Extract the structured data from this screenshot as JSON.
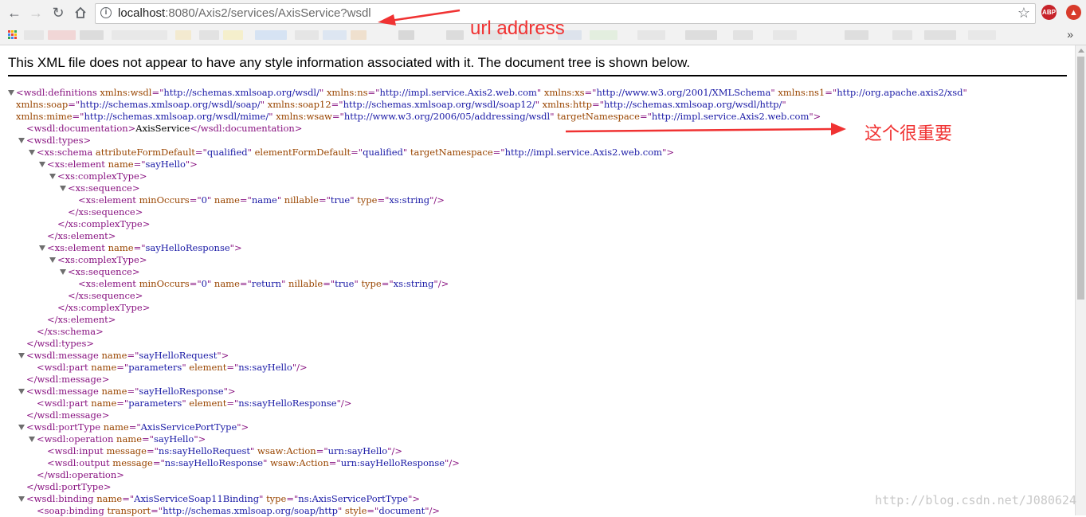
{
  "browser": {
    "url_host": "localhost",
    "url_rest": ":8080/Axis2/services/AxisService?wsdl",
    "extensions": [
      {
        "label": "ABP",
        "color": "#c7232a"
      },
      {
        "label": "",
        "color": "#d83b2b"
      }
    ]
  },
  "annotations": {
    "url_label": "url address",
    "namespace_label": "这个很重要",
    "color": "#f03232"
  },
  "page": {
    "notice": "This XML file does not appear to have any style information associated with it. The document tree is shown below."
  },
  "xml_lines": [
    {
      "indent": 0,
      "toggle": true,
      "parts": [
        [
          "t",
          "<wsdl:definitions"
        ],
        [
          "s",
          " "
        ],
        [
          "a",
          "xmlns:wsdl"
        ],
        [
          "t",
          "=\""
        ],
        [
          "v",
          "http://schemas.xmlsoap.org/wsdl/"
        ],
        [
          "t",
          "\""
        ],
        [
          "s",
          " "
        ],
        [
          "a",
          "xmlns:ns"
        ],
        [
          "t",
          "=\""
        ],
        [
          "v",
          "http://impl.service.Axis2.web.com"
        ],
        [
          "t",
          "\""
        ],
        [
          "s",
          " "
        ],
        [
          "a",
          "xmlns:xs"
        ],
        [
          "t",
          "=\""
        ],
        [
          "v",
          "http://www.w3.org/2001/XMLSchema"
        ],
        [
          "t",
          "\""
        ],
        [
          "s",
          " "
        ],
        [
          "a",
          "xmlns:ns1"
        ],
        [
          "t",
          "=\""
        ],
        [
          "v",
          "http://org.apache.axis2/xsd"
        ],
        [
          "t",
          "\""
        ]
      ]
    },
    {
      "indent": 0,
      "wrap": true,
      "parts": [
        [
          "a",
          "xmlns:soap"
        ],
        [
          "t",
          "=\""
        ],
        [
          "v",
          "http://schemas.xmlsoap.org/wsdl/soap/"
        ],
        [
          "t",
          "\""
        ],
        [
          "s",
          " "
        ],
        [
          "a",
          "xmlns:soap12"
        ],
        [
          "t",
          "=\""
        ],
        [
          "v",
          "http://schemas.xmlsoap.org/wsdl/soap12/"
        ],
        [
          "t",
          "\""
        ],
        [
          "s",
          " "
        ],
        [
          "a",
          "xmlns:http"
        ],
        [
          "t",
          "=\""
        ],
        [
          "v",
          "http://schemas.xmlsoap.org/wsdl/http/"
        ],
        [
          "t",
          "\""
        ]
      ]
    },
    {
      "indent": 0,
      "wrap": true,
      "parts": [
        [
          "a",
          "xmlns:mime"
        ],
        [
          "t",
          "=\""
        ],
        [
          "v",
          "http://schemas.xmlsoap.org/wsdl/mime/"
        ],
        [
          "t",
          "\""
        ],
        [
          "s",
          " "
        ],
        [
          "a",
          "xmlns:wsaw"
        ],
        [
          "t",
          "=\""
        ],
        [
          "v",
          "http://www.w3.org/2006/05/addressing/wsdl"
        ],
        [
          "t",
          "\""
        ],
        [
          "s",
          " "
        ],
        [
          "a",
          "targetNamespace"
        ],
        [
          "t",
          "=\""
        ],
        [
          "v",
          "http://impl.service.Axis2.web.com"
        ],
        [
          "t",
          "\">"
        ]
      ]
    },
    {
      "indent": 1,
      "parts": [
        [
          "t",
          "<wsdl:documentation>"
        ],
        [
          "x",
          "AxisService"
        ],
        [
          "t",
          "</wsdl:documentation>"
        ]
      ]
    },
    {
      "indent": 1,
      "toggle": true,
      "parts": [
        [
          "t",
          "<wsdl:types>"
        ]
      ]
    },
    {
      "indent": 2,
      "toggle": true,
      "parts": [
        [
          "t",
          "<xs:schema"
        ],
        [
          "s",
          " "
        ],
        [
          "a",
          "attributeFormDefault"
        ],
        [
          "t",
          "=\""
        ],
        [
          "v",
          "qualified"
        ],
        [
          "t",
          "\""
        ],
        [
          "s",
          " "
        ],
        [
          "a",
          "elementFormDefault"
        ],
        [
          "t",
          "=\""
        ],
        [
          "v",
          "qualified"
        ],
        [
          "t",
          "\""
        ],
        [
          "s",
          " "
        ],
        [
          "a",
          "targetNamespace"
        ],
        [
          "t",
          "=\""
        ],
        [
          "v",
          "http://impl.service.Axis2.web.com"
        ],
        [
          "t",
          "\">"
        ]
      ]
    },
    {
      "indent": 3,
      "toggle": true,
      "parts": [
        [
          "t",
          "<xs:element"
        ],
        [
          "s",
          " "
        ],
        [
          "a",
          "name"
        ],
        [
          "t",
          "=\""
        ],
        [
          "v",
          "sayHello"
        ],
        [
          "t",
          "\">"
        ]
      ]
    },
    {
      "indent": 4,
      "toggle": true,
      "parts": [
        [
          "t",
          "<xs:complexType>"
        ]
      ]
    },
    {
      "indent": 5,
      "toggle": true,
      "parts": [
        [
          "t",
          "<xs:sequence>"
        ]
      ]
    },
    {
      "indent": 6,
      "parts": [
        [
          "t",
          "<xs:element"
        ],
        [
          "s",
          " "
        ],
        [
          "a",
          "minOccurs"
        ],
        [
          "t",
          "=\""
        ],
        [
          "v",
          "0"
        ],
        [
          "t",
          "\""
        ],
        [
          "s",
          " "
        ],
        [
          "a",
          "name"
        ],
        [
          "t",
          "=\""
        ],
        [
          "v",
          "name"
        ],
        [
          "t",
          "\""
        ],
        [
          "s",
          " "
        ],
        [
          "a",
          "nillable"
        ],
        [
          "t",
          "=\""
        ],
        [
          "v",
          "true"
        ],
        [
          "t",
          "\""
        ],
        [
          "s",
          " "
        ],
        [
          "a",
          "type"
        ],
        [
          "t",
          "=\""
        ],
        [
          "v",
          "xs:string"
        ],
        [
          "t",
          "\"/>"
        ]
      ]
    },
    {
      "indent": 5,
      "parts": [
        [
          "t",
          "</xs:sequence>"
        ]
      ]
    },
    {
      "indent": 4,
      "parts": [
        [
          "t",
          "</xs:complexType>"
        ]
      ]
    },
    {
      "indent": 3,
      "parts": [
        [
          "t",
          "</xs:element>"
        ]
      ]
    },
    {
      "indent": 3,
      "toggle": true,
      "parts": [
        [
          "t",
          "<xs:element"
        ],
        [
          "s",
          " "
        ],
        [
          "a",
          "name"
        ],
        [
          "t",
          "=\""
        ],
        [
          "v",
          "sayHelloResponse"
        ],
        [
          "t",
          "\">"
        ]
      ]
    },
    {
      "indent": 4,
      "toggle": true,
      "parts": [
        [
          "t",
          "<xs:complexType>"
        ]
      ]
    },
    {
      "indent": 5,
      "toggle": true,
      "parts": [
        [
          "t",
          "<xs:sequence>"
        ]
      ]
    },
    {
      "indent": 6,
      "parts": [
        [
          "t",
          "<xs:element"
        ],
        [
          "s",
          " "
        ],
        [
          "a",
          "minOccurs"
        ],
        [
          "t",
          "=\""
        ],
        [
          "v",
          "0"
        ],
        [
          "t",
          "\""
        ],
        [
          "s",
          " "
        ],
        [
          "a",
          "name"
        ],
        [
          "t",
          "=\""
        ],
        [
          "v",
          "return"
        ],
        [
          "t",
          "\""
        ],
        [
          "s",
          " "
        ],
        [
          "a",
          "nillable"
        ],
        [
          "t",
          "=\""
        ],
        [
          "v",
          "true"
        ],
        [
          "t",
          "\""
        ],
        [
          "s",
          " "
        ],
        [
          "a",
          "type"
        ],
        [
          "t",
          "=\""
        ],
        [
          "v",
          "xs:string"
        ],
        [
          "t",
          "\"/>"
        ]
      ]
    },
    {
      "indent": 5,
      "parts": [
        [
          "t",
          "</xs:sequence>"
        ]
      ]
    },
    {
      "indent": 4,
      "parts": [
        [
          "t",
          "</xs:complexType>"
        ]
      ]
    },
    {
      "indent": 3,
      "parts": [
        [
          "t",
          "</xs:element>"
        ]
      ]
    },
    {
      "indent": 2,
      "parts": [
        [
          "t",
          "</xs:schema>"
        ]
      ]
    },
    {
      "indent": 1,
      "parts": [
        [
          "t",
          "</wsdl:types>"
        ]
      ]
    },
    {
      "indent": 1,
      "toggle": true,
      "parts": [
        [
          "t",
          "<wsdl:message"
        ],
        [
          "s",
          " "
        ],
        [
          "a",
          "name"
        ],
        [
          "t",
          "=\""
        ],
        [
          "v",
          "sayHelloRequest"
        ],
        [
          "t",
          "\">"
        ]
      ]
    },
    {
      "indent": 2,
      "parts": [
        [
          "t",
          "<wsdl:part"
        ],
        [
          "s",
          " "
        ],
        [
          "a",
          "name"
        ],
        [
          "t",
          "=\""
        ],
        [
          "v",
          "parameters"
        ],
        [
          "t",
          "\""
        ],
        [
          "s",
          " "
        ],
        [
          "a",
          "element"
        ],
        [
          "t",
          "=\""
        ],
        [
          "v",
          "ns:sayHello"
        ],
        [
          "t",
          "\"/>"
        ]
      ]
    },
    {
      "indent": 1,
      "parts": [
        [
          "t",
          "</wsdl:message>"
        ]
      ]
    },
    {
      "indent": 1,
      "toggle": true,
      "parts": [
        [
          "t",
          "<wsdl:message"
        ],
        [
          "s",
          " "
        ],
        [
          "a",
          "name"
        ],
        [
          "t",
          "=\""
        ],
        [
          "v",
          "sayHelloResponse"
        ],
        [
          "t",
          "\">"
        ]
      ]
    },
    {
      "indent": 2,
      "parts": [
        [
          "t",
          "<wsdl:part"
        ],
        [
          "s",
          " "
        ],
        [
          "a",
          "name"
        ],
        [
          "t",
          "=\""
        ],
        [
          "v",
          "parameters"
        ],
        [
          "t",
          "\""
        ],
        [
          "s",
          " "
        ],
        [
          "a",
          "element"
        ],
        [
          "t",
          "=\""
        ],
        [
          "v",
          "ns:sayHelloResponse"
        ],
        [
          "t",
          "\"/>"
        ]
      ]
    },
    {
      "indent": 1,
      "parts": [
        [
          "t",
          "</wsdl:message>"
        ]
      ]
    },
    {
      "indent": 1,
      "toggle": true,
      "parts": [
        [
          "t",
          "<wsdl:portType"
        ],
        [
          "s",
          " "
        ],
        [
          "a",
          "name"
        ],
        [
          "t",
          "=\""
        ],
        [
          "v",
          "AxisServicePortType"
        ],
        [
          "t",
          "\">"
        ]
      ]
    },
    {
      "indent": 2,
      "toggle": true,
      "parts": [
        [
          "t",
          "<wsdl:operation"
        ],
        [
          "s",
          " "
        ],
        [
          "a",
          "name"
        ],
        [
          "t",
          "=\""
        ],
        [
          "v",
          "sayHello"
        ],
        [
          "t",
          "\">"
        ]
      ]
    },
    {
      "indent": 3,
      "parts": [
        [
          "t",
          "<wsdl:input"
        ],
        [
          "s",
          " "
        ],
        [
          "a",
          "message"
        ],
        [
          "t",
          "=\""
        ],
        [
          "v",
          "ns:sayHelloRequest"
        ],
        [
          "t",
          "\""
        ],
        [
          "s",
          " "
        ],
        [
          "a",
          "wsaw:Action"
        ],
        [
          "t",
          "=\""
        ],
        [
          "v",
          "urn:sayHello"
        ],
        [
          "t",
          "\"/>"
        ]
      ]
    },
    {
      "indent": 3,
      "parts": [
        [
          "t",
          "<wsdl:output"
        ],
        [
          "s",
          " "
        ],
        [
          "a",
          "message"
        ],
        [
          "t",
          "=\""
        ],
        [
          "v",
          "ns:sayHelloResponse"
        ],
        [
          "t",
          "\""
        ],
        [
          "s",
          " "
        ],
        [
          "a",
          "wsaw:Action"
        ],
        [
          "t",
          "=\""
        ],
        [
          "v",
          "urn:sayHelloResponse"
        ],
        [
          "t",
          "\"/>"
        ]
      ]
    },
    {
      "indent": 2,
      "parts": [
        [
          "t",
          "</wsdl:operation>"
        ]
      ]
    },
    {
      "indent": 1,
      "parts": [
        [
          "t",
          "</wsdl:portType>"
        ]
      ]
    },
    {
      "indent": 1,
      "toggle": true,
      "parts": [
        [
          "t",
          "<wsdl:binding"
        ],
        [
          "s",
          " "
        ],
        [
          "a",
          "name"
        ],
        [
          "t",
          "=\""
        ],
        [
          "v",
          "AxisServiceSoap11Binding"
        ],
        [
          "t",
          "\""
        ],
        [
          "s",
          " "
        ],
        [
          "a",
          "type"
        ],
        [
          "t",
          "=\""
        ],
        [
          "v",
          "ns:AxisServicePortType"
        ],
        [
          "t",
          "\">"
        ]
      ]
    },
    {
      "indent": 2,
      "parts": [
        [
          "t",
          "<soap:binding"
        ],
        [
          "s",
          " "
        ],
        [
          "a",
          "transport"
        ],
        [
          "t",
          "=\""
        ],
        [
          "v",
          "http://schemas.xmlsoap.org/soap/http"
        ],
        [
          "t",
          "\""
        ],
        [
          "s",
          " "
        ],
        [
          "a",
          "style"
        ],
        [
          "t",
          "=\""
        ],
        [
          "v",
          "document"
        ],
        [
          "t",
          "\"/>"
        ]
      ]
    }
  ],
  "watermark": "http://blog.csdn.net/J080624"
}
